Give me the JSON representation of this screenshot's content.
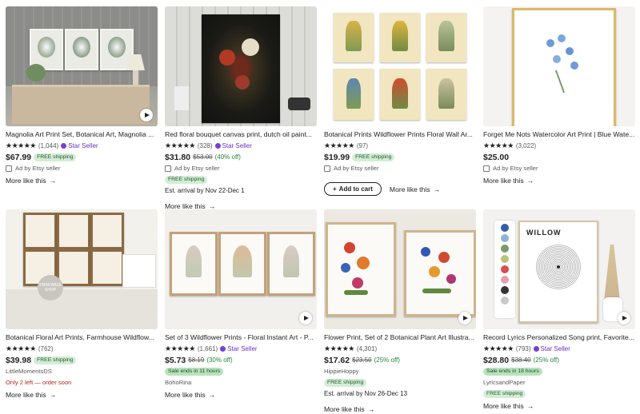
{
  "cards": [
    {
      "title": "Magnolia Art Print Set, Botanical Art, Magnolia ...",
      "stars": "★★★★★",
      "reviews": "(1,044)",
      "star_seller": "Star Seller",
      "price": "$67.99",
      "shipping": "FREE shipping",
      "ad": "Ad by Etsy seller",
      "more": "More like this"
    },
    {
      "title": "Red floral bouquet canvas print, dutch oil paint...",
      "stars": "★★★★★",
      "reviews": "(328)",
      "star_seller": "Star Seller",
      "price": "$31.80",
      "old_price": "$53.00",
      "discount": "(40% off)",
      "ad": "Ad by Etsy seller",
      "shipping": "FREE shipping",
      "arrival": "Est. arrival by Nov 22-Dec 1",
      "more": "More like this"
    },
    {
      "title": "Botanical Prints Wildflower Prints Floral Wall Ar...",
      "stars": "★★★★★",
      "reviews": "(97)",
      "price": "$19.99",
      "shipping": "FREE shipping",
      "ad": "Ad by Etsy seller",
      "cart": "Add to cart",
      "more": "More like this"
    },
    {
      "title": "Forget Me Nots Watercolor Art Print | Blue Wate...",
      "stars": "★★★★★",
      "reviews": "(3,022)",
      "price": "$25.00",
      "ad": "Ad by Etsy seller",
      "more": "More like this"
    },
    {
      "title": "Botanical Floral Art Prints, Farmhouse Wildflow...",
      "stars": "★★★★★",
      "reviews": "(762)",
      "price": "$39.98",
      "shipping": "FREE shipping",
      "shop": "LittleMomentsDS",
      "stock": "Only 2 left — order soon",
      "more": "More like this",
      "watermark": "PRINTABLE SHOP"
    },
    {
      "title": "Set of 3 Wildflower Prints - Floral Instant Art - P...",
      "stars": "★★★★★",
      "reviews": "(1,661)",
      "star_seller": "Star Seller",
      "price": "$5.73",
      "old_price": "$8.19",
      "discount": "(30% off)",
      "sale": "Sale ends in 11 hours",
      "shop": "BohoRina",
      "more": "More like this"
    },
    {
      "title": "Flower Print, Set of 2 Botanical Plant Art Illustra...",
      "stars": "★★★★★",
      "reviews": "(4,301)",
      "price": "$17.62",
      "old_price": "$23.50",
      "discount": "(25% off)",
      "shop": "HippieHoppy",
      "shipping": "FREE shipping",
      "arrival": "Est. arrival by Nov 26-Dec 13",
      "more": "More like this"
    },
    {
      "title": "Record Lyrics Personalized Song print, Favorite...",
      "stars": "★★★★★",
      "reviews": "(793)",
      "star_seller": "Star Seller",
      "price": "$28.80",
      "old_price": "$38.40",
      "discount": "(25% off)",
      "sale": "Sale ends in 18 hours",
      "shop": "LyricsandPaper",
      "shipping": "FREE shipping",
      "more": "More like this",
      "record_title": "WILLOW"
    }
  ],
  "colors": {
    "star_seller": "#6b2fbd",
    "shipping_bg": "#d4ecd6",
    "urgent": "#b3261e",
    "discount": "#258635"
  }
}
